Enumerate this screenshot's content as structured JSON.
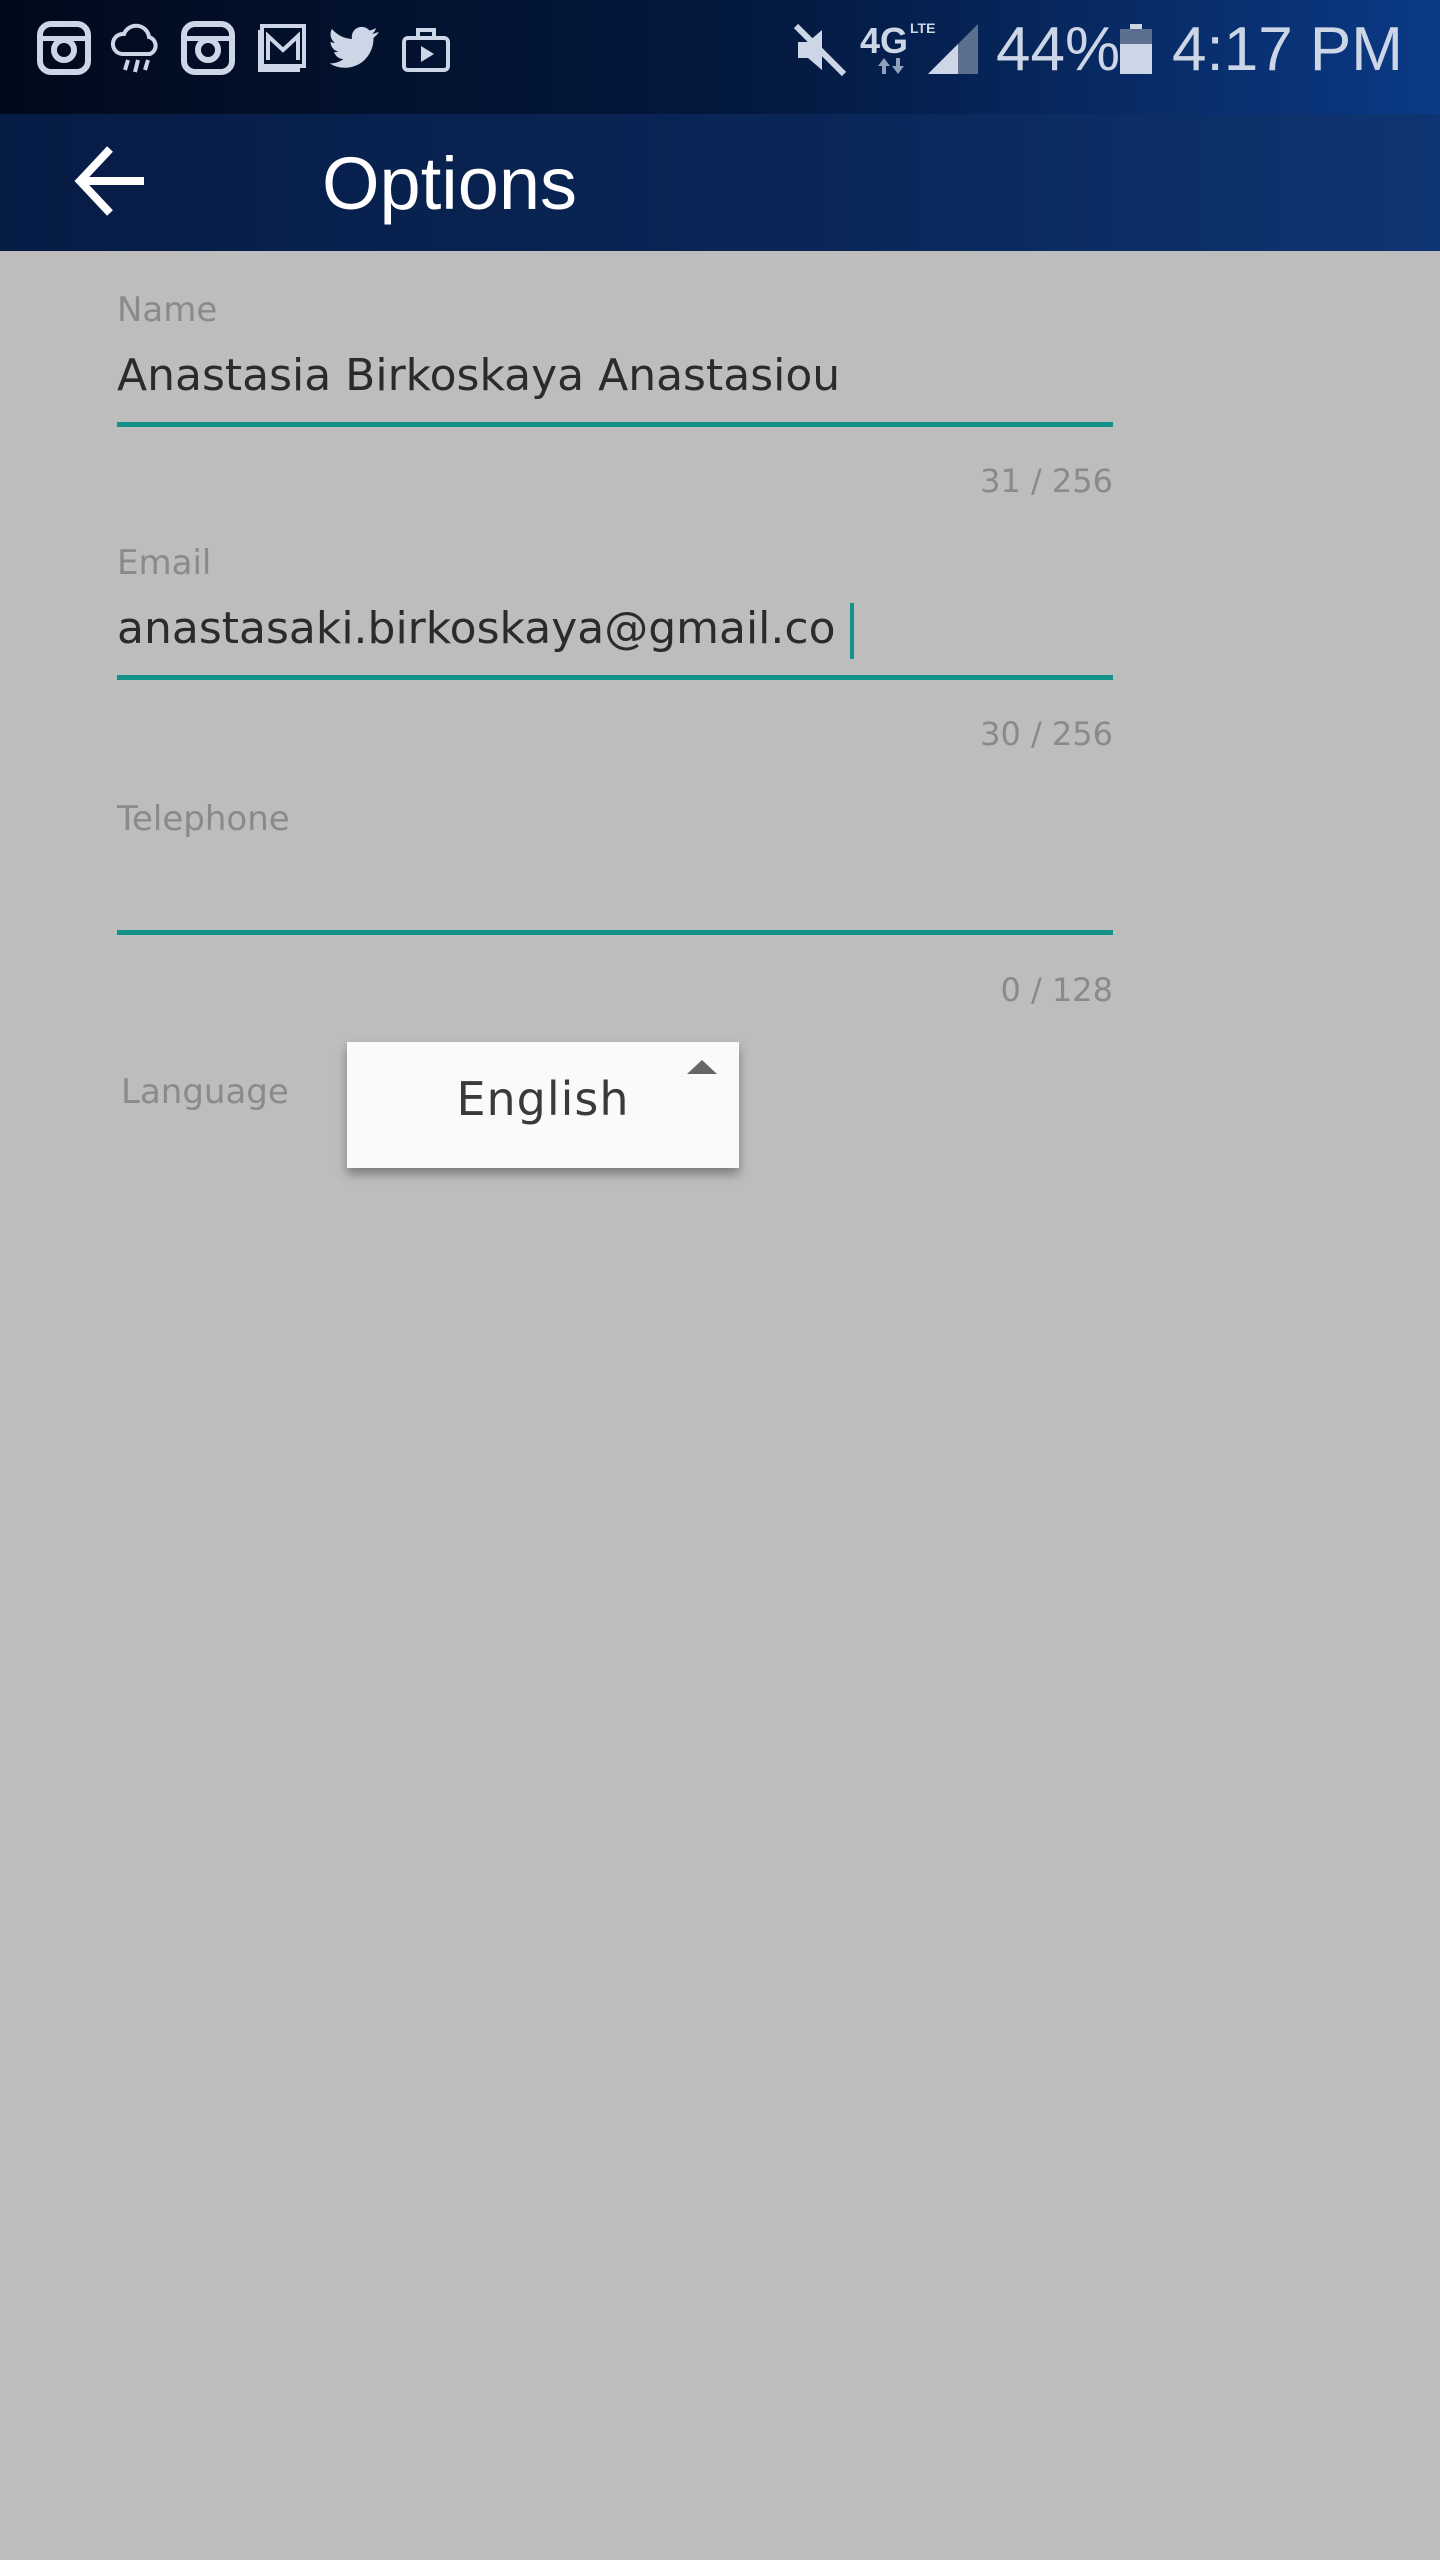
{
  "status_bar": {
    "left_icons": [
      "instagram-icon",
      "cloud-rain-icon",
      "instagram-icon",
      "mail-icon",
      "twitter-icon",
      "briefcase-play-icon"
    ],
    "network": "4G",
    "network_sub": "LTE",
    "battery": "44%",
    "time": "4:17 PM"
  },
  "app_bar": {
    "title": "Options",
    "back_icon": "arrow-left-icon"
  },
  "form": {
    "name": {
      "label": "Name",
      "value": "Anastasia Birkoskaya Anastasiou",
      "counter": "31 / 256"
    },
    "email": {
      "label": "Email",
      "value": "anastasaki.birkoskaya@gmail.co",
      "counter": "30 / 256"
    },
    "telephone": {
      "label": "Telephone",
      "value": "",
      "counter": "0 / 128"
    },
    "language": {
      "label": "Language",
      "selected": "English"
    }
  },
  "colors": {
    "accent": "#13928a",
    "background": "#bdbdbd",
    "app_bar": "#0a2759"
  }
}
